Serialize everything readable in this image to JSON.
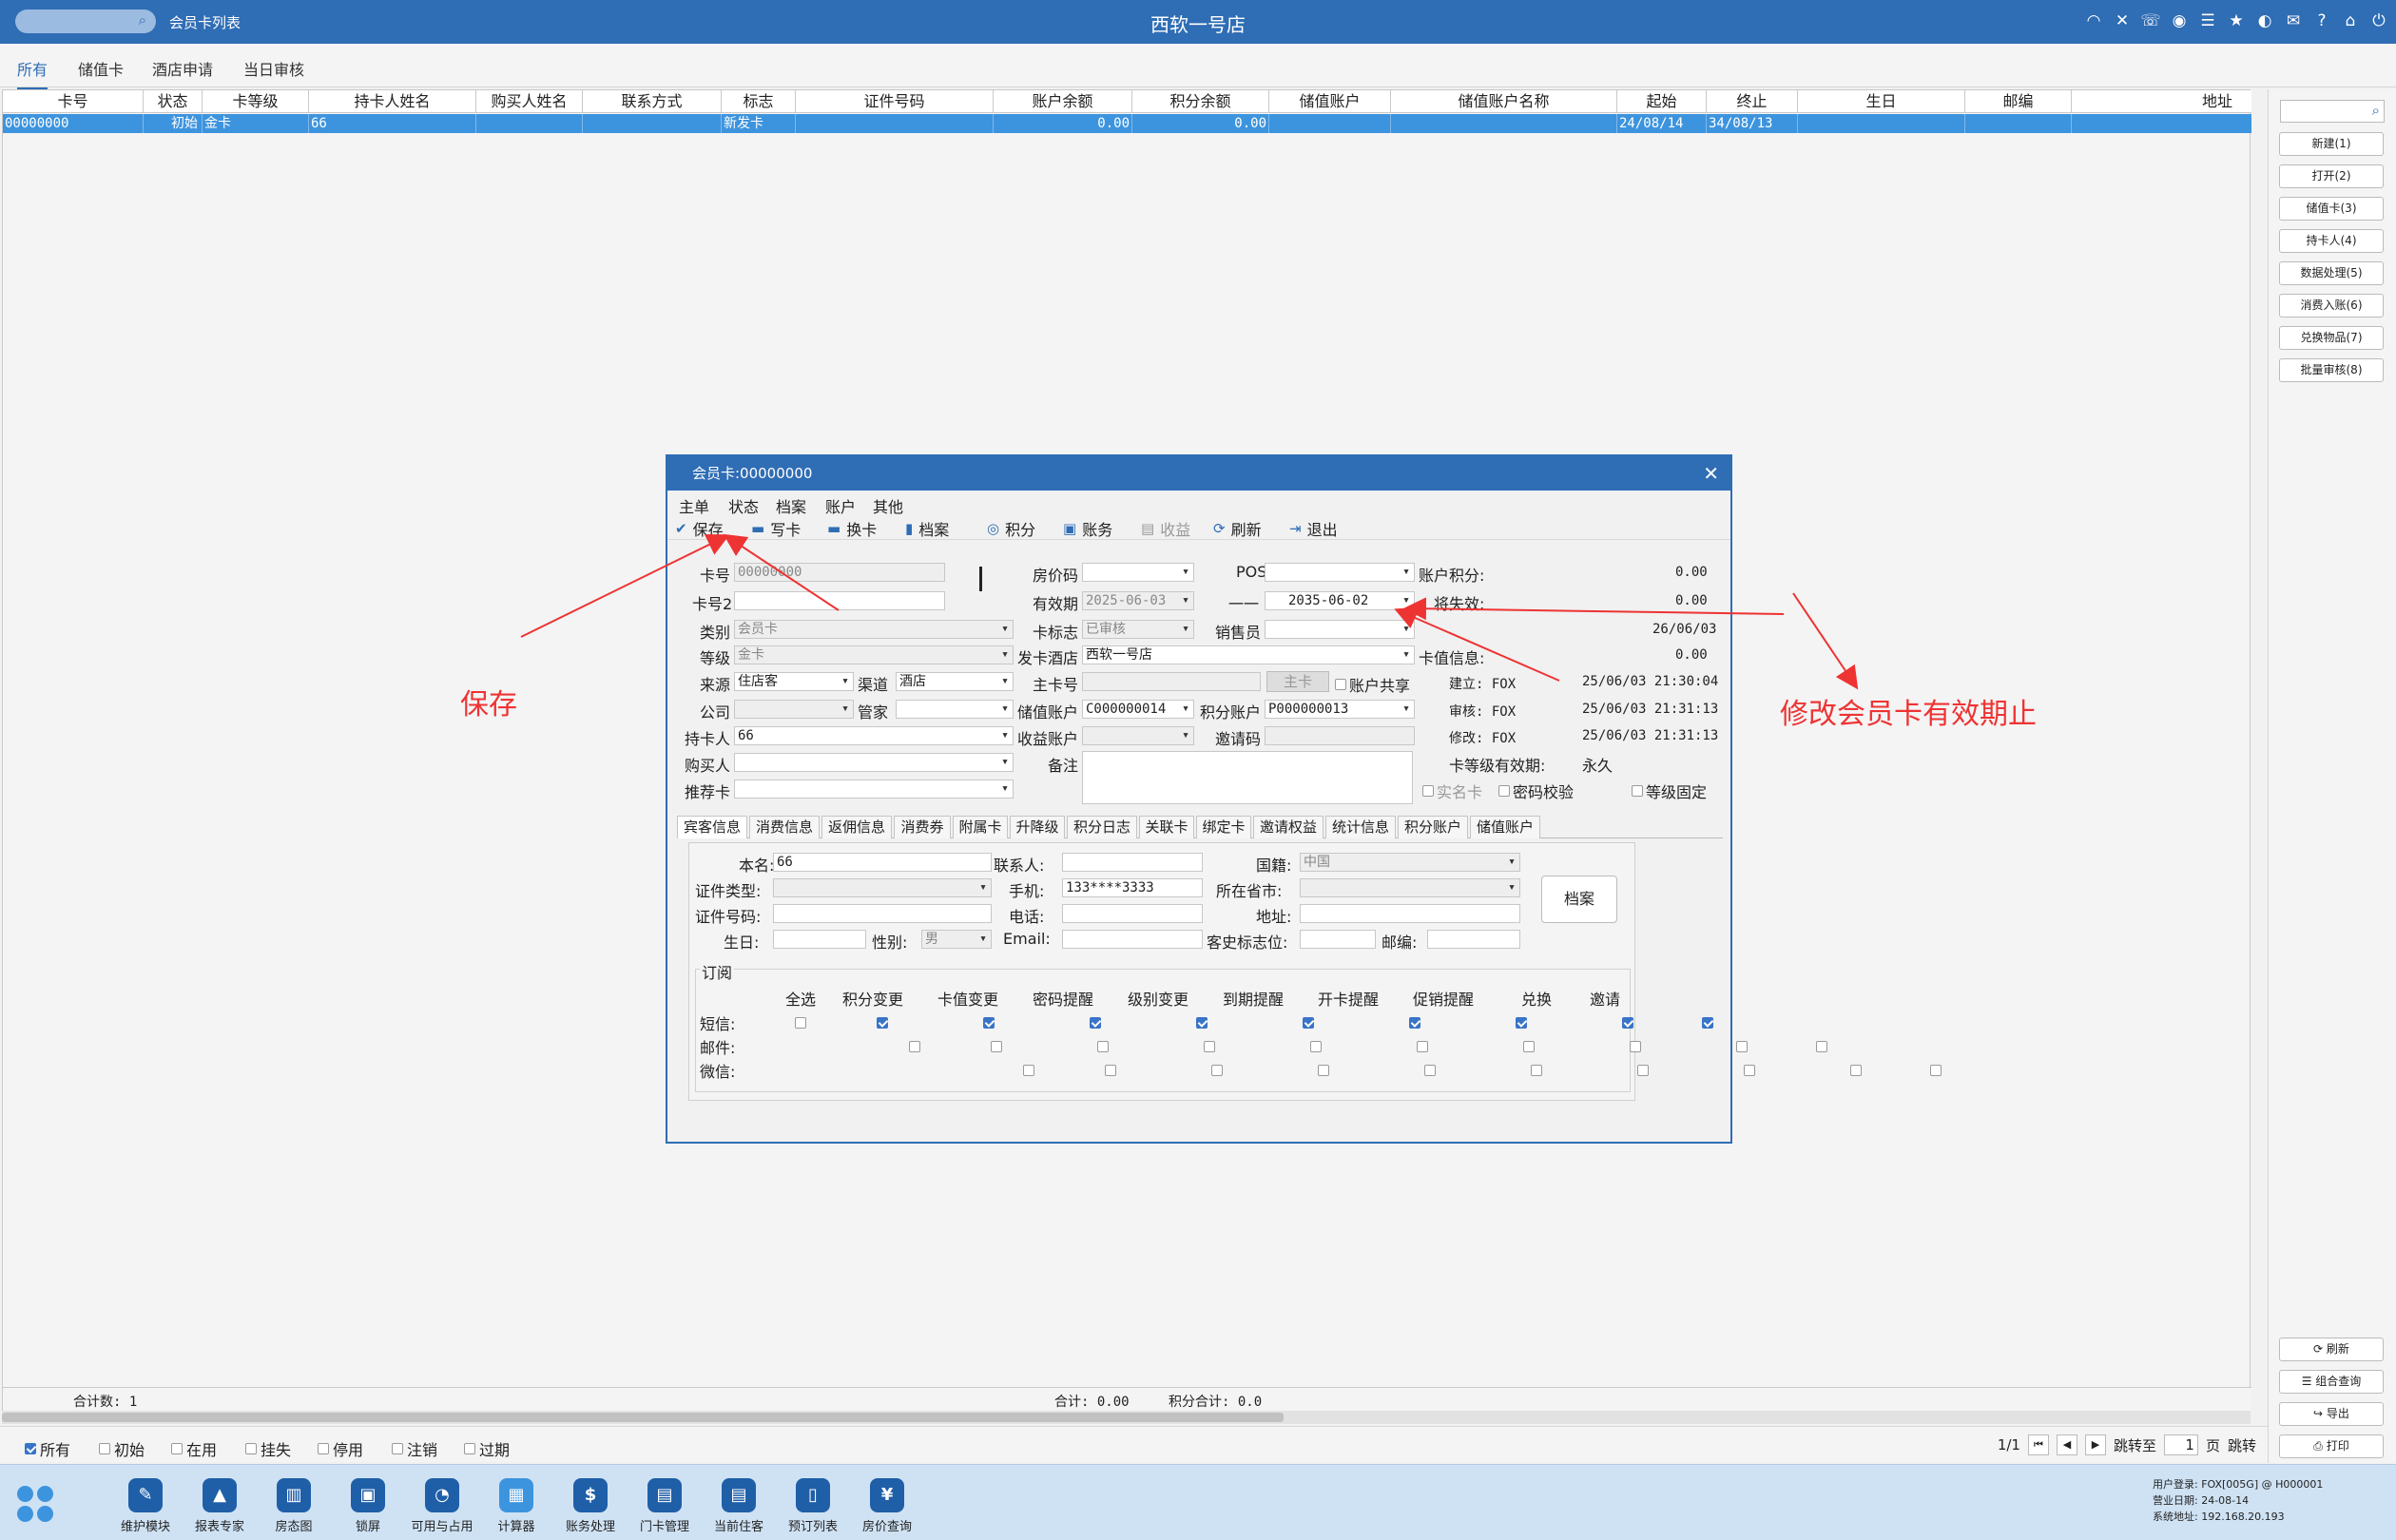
{
  "app": {
    "window_title": "会员卡列表",
    "store_name": "西软一号店",
    "top_icons": [
      "wifi-icon",
      "tools-icon",
      "phone-icon",
      "palette-icon",
      "menu-icon",
      "star-icon",
      "moon-icon",
      "mail-icon",
      "help-icon",
      "home-icon",
      "power-icon"
    ]
  },
  "tabs": [
    "所有",
    "储值卡",
    "酒店申请",
    "当日审核"
  ],
  "grid": {
    "headers": [
      "卡号",
      "状态",
      "卡等级",
      "持卡人姓名",
      "购买人姓名",
      "联系方式",
      "标志",
      "证件号码",
      "账户余额",
      "积分余额",
      "储值账户",
      "储值账户名称",
      "起始",
      "终止",
      "生日",
      "邮编",
      "地址"
    ],
    "row": {
      "card_no": "00000000",
      "status": "初始",
      "level": "金卡",
      "holder": "66",
      "flag": "新发卡",
      "balance": "0.00",
      "points": "0.00",
      "start": "24/08/14",
      "end": "34/08/13"
    },
    "footer": {
      "count": "合计数: 1",
      "total": "合计: 0.00",
      "points_total": "积分合计: 0.0"
    }
  },
  "right_panel": {
    "buttons": [
      "新建(1)",
      "打开(2)",
      "储值卡(3)",
      "持卡人(4)",
      "数据处理(5)",
      "消费入账(6)",
      "兑换物品(7)",
      "批量审核(8)"
    ],
    "bottom_buttons": [
      "刷新",
      "组合查询",
      "导出",
      "打印"
    ]
  },
  "statusbar": {
    "filters": [
      {
        "label": "所有",
        "checked": true
      },
      {
        "label": "初始",
        "checked": false
      },
      {
        "label": "在用",
        "checked": false
      },
      {
        "label": "挂失",
        "checked": false
      },
      {
        "label": "停用",
        "checked": false
      },
      {
        "label": "注销",
        "checked": false
      },
      {
        "label": "过期",
        "checked": false
      }
    ],
    "page": "1/1",
    "jump_label": "跳转至",
    "page_input": "1",
    "page_unit": "页",
    "jump_btn": "跳转"
  },
  "taskbar": {
    "items": [
      "维护模块",
      "报表专家",
      "房态图",
      "锁屏",
      "可用与占用",
      "计算器",
      "账务处理",
      "门卡管理",
      "当前住客",
      "预订列表",
      "房价查询"
    ],
    "info": [
      "用户登录: FOX[005G] @ H000001",
      "营业日期: 24-08-14",
      "系统地址: 192.168.20.193"
    ]
  },
  "dialog": {
    "title": "会员卡:00000000",
    "menu": [
      "主单",
      "状态",
      "档案",
      "账户",
      "其他"
    ],
    "toolbar": [
      "保存",
      "写卡",
      "换卡",
      "档案",
      "积分",
      "账务",
      "收益",
      "刷新",
      "退出"
    ],
    "labels": {
      "card_no": "卡号",
      "card_no2": "卡号2",
      "category": "类别",
      "level": "等级",
      "source": "来源",
      "channel": "渠道",
      "company": "公司",
      "butler": "管家",
      "holder": "持卡人",
      "buyer": "购买人",
      "referrer": "推荐卡",
      "rate_code": "房价码",
      "valid": "有效期",
      "card_flag": "卡标志",
      "issue_hotel": "发卡酒店",
      "main_card": "主卡号",
      "stored_acct": "储值账户",
      "profit_acct": "收益账户",
      "remark": "备注",
      "pos": "POS",
      "dash": "一一",
      "salesman": "销售员",
      "points_acct": "积分账户",
      "invite": "邀请码",
      "acct_points": "账户积分:",
      "expiring": "将失效:",
      "card_value": "卡值信息:",
      "created": "建立: FOX",
      "audited": "审核: FOX",
      "modified": "修改: FOX",
      "level_valid": "卡等级有效期:",
      "acct_share": "账户共享",
      "main_card_btn": "主卡",
      "real_name": "实名卡",
      "pwd_check": "密码校验",
      "level_fixed": "等级固定"
    },
    "values": {
      "card_no": "00000000",
      "category": "会员卡",
      "level": "金卡",
      "source": "住店客",
      "channel": "酒店",
      "holder": "66",
      "valid_from": "2025-06-03",
      "valid_to": "2035-06-02",
      "card_flag": "已审核",
      "issue_hotel": "西软一号店",
      "stored_acct": "C000000014",
      "points_acct": "P000000013",
      "acct_points": "0.00",
      "expiring": "0.00",
      "date_line": "26/06/03",
      "card_value": "0.00",
      "created_at": "25/06/03 21:30:04",
      "audited_at": "25/06/03 21:31:13",
      "modified_at": "25/06/03 21:31:13",
      "level_valid": "永久"
    },
    "subtabs": [
      "宾客信息",
      "消费信息",
      "返佣信息",
      "消费券",
      "附属卡",
      "升降级",
      "积分日志",
      "关联卡",
      "绑定卡",
      "邀请权益",
      "统计信息",
      "积分账户",
      "储值账户"
    ],
    "guest": {
      "labels": {
        "name": "本名:",
        "contact": "联系人:",
        "nation": "国籍:",
        "id_type": "证件类型:",
        "mobile": "手机:",
        "province": "所在省市:",
        "id_no": "证件号码:",
        "phone": "电话:",
        "address": "地址:",
        "birthday": "生日:",
        "gender": "性别:",
        "email": "Email:",
        "history": "客史标志位:",
        "zip": "邮编:"
      },
      "name": "66",
      "mobile": "133****3333",
      "nation": "中国",
      "gender": "男",
      "archive_btn": "档案"
    },
    "subscribe": {
      "title": "订阅",
      "columns": [
        "全选",
        "积分变更",
        "卡值变更",
        "密码提醒",
        "级别变更",
        "到期提醒",
        "开卡提醒",
        "促销提醒",
        "兑换",
        "邀请"
      ],
      "rows": [
        {
          "label": "短信:",
          "checks": [
            false,
            true,
            true,
            true,
            true,
            true,
            true,
            true,
            true,
            true
          ]
        },
        {
          "label": "邮件:",
          "checks": [
            false,
            false,
            false,
            false,
            false,
            false,
            false,
            false,
            false,
            false
          ]
        },
        {
          "label": "微信:",
          "checks": [
            false,
            false,
            false,
            false,
            false,
            false,
            false,
            false,
            false,
            false
          ]
        }
      ]
    }
  },
  "annotations": {
    "save": "保存",
    "modify": "修改会员卡有效期止"
  },
  "colors": {
    "primary": "#2f6db5",
    "selected_row": "#3d94de",
    "annotation": "#ee3333"
  }
}
